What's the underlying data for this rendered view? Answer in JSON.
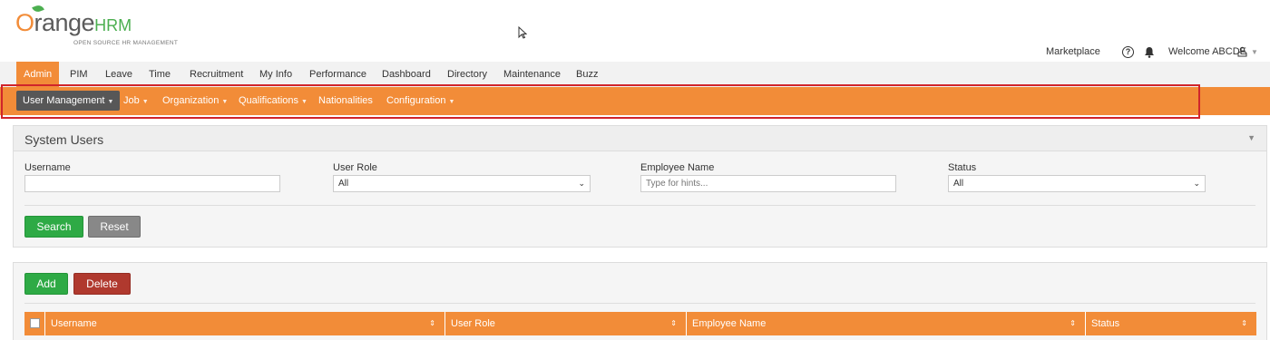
{
  "header": {
    "logo_o": "O",
    "logo_range": "range",
    "logo_hrm": "HRM",
    "logo_tagline": "OPEN SOURCE HR MANAGEMENT",
    "marketplace": "Marketplace",
    "welcome": "Welcome ABCDE"
  },
  "top_menu": {
    "items": [
      "Admin",
      "PIM",
      "Leave",
      "Time",
      "Recruitment",
      "My Info",
      "Performance",
      "Dashboard",
      "Directory",
      "Maintenance",
      "Buzz"
    ]
  },
  "sub_menu": {
    "items": [
      {
        "label": "User Management"
      },
      {
        "label": "Job"
      },
      {
        "label": "Organization"
      },
      {
        "label": "Qualifications"
      },
      {
        "label": "Nationalities"
      },
      {
        "label": "Configuration"
      }
    ]
  },
  "search_panel": {
    "title": "System Users",
    "username_label": "Username",
    "username_value": "",
    "user_role_label": "User Role",
    "user_role_value": "All",
    "employee_name_label": "Employee Name",
    "employee_name_placeholder": "Type for hints...",
    "status_label": "Status",
    "status_value": "All",
    "search_button": "Search",
    "reset_button": "Reset"
  },
  "results_panel": {
    "add_button": "Add",
    "delete_button": "Delete",
    "columns": [
      "Username",
      "User Role",
      "Employee Name",
      "Status"
    ]
  },
  "colors": {
    "accent": "#f28c38",
    "active_sub": "#575757",
    "highlight": "#d0252b",
    "green": "#2eaa45",
    "red": "#b0392e"
  }
}
